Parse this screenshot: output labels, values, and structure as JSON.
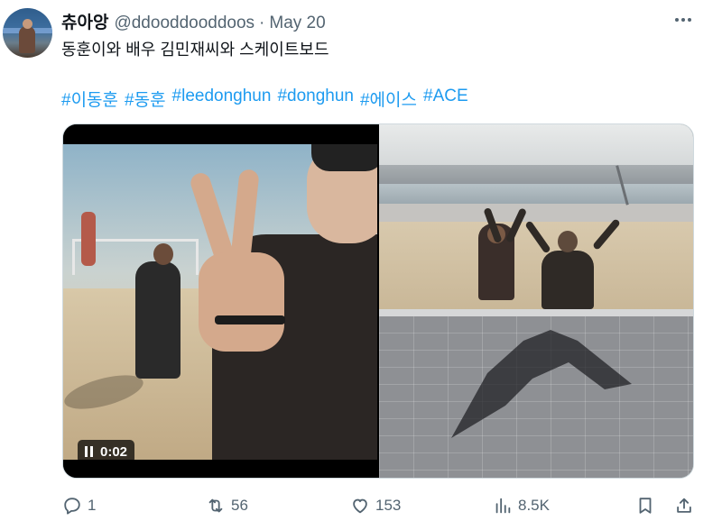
{
  "tweet": {
    "display_name": "츄아앙",
    "handle": "@ddooddooddoos",
    "separator": "·",
    "date": "May 20",
    "text": "동훈이와 배우 김민재씨와 스케이트보드",
    "hashtags": [
      "#이동훈",
      "#동훈",
      "#leedonghun",
      "#donghun",
      "#에이스",
      "#ACE"
    ]
  },
  "media": {
    "video_time": "0:02"
  },
  "actions": {
    "reply_count": "1",
    "retweet_count": "56",
    "like_count": "153",
    "views_count": "8.5K"
  },
  "icons": [
    "more-icon",
    "pause-icon",
    "reply-icon",
    "retweet-icon",
    "like-icon",
    "views-icon",
    "bookmark-icon",
    "share-icon"
  ],
  "colors": {
    "link": "#1d9bf0",
    "muted": "#536471",
    "text": "#0f1419"
  }
}
